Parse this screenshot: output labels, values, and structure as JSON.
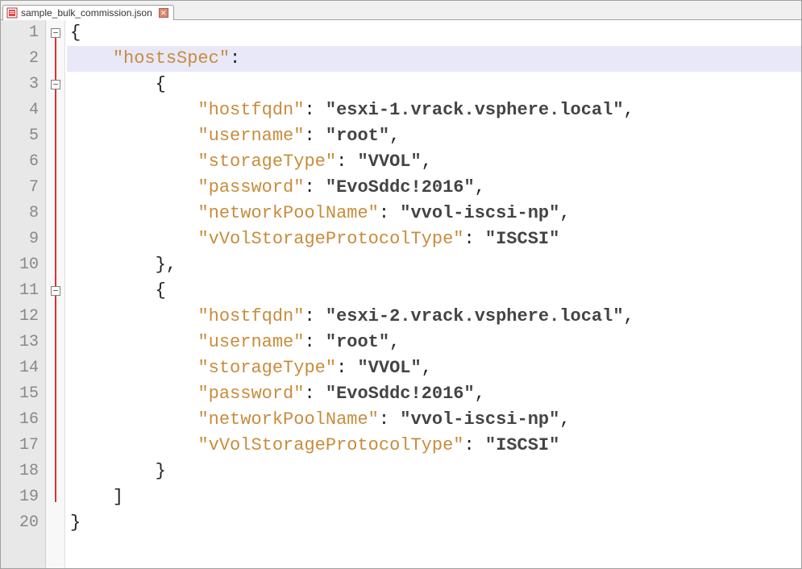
{
  "tab": {
    "filename": "sample_bulk_commission.json",
    "close_glyph": "✕"
  },
  "gutter": {
    "lines": [
      "1",
      "2",
      "3",
      "4",
      "5",
      "6",
      "7",
      "8",
      "9",
      "10",
      "11",
      "12",
      "13",
      "14",
      "15",
      "16",
      "17",
      "18",
      "19",
      "20"
    ]
  },
  "fold": {
    "marks": [
      {
        "line": 1,
        "glyph": "−"
      },
      {
        "line": 3,
        "glyph": "−"
      },
      {
        "line": 11,
        "glyph": "−"
      }
    ]
  },
  "code": {
    "tokens": [
      [
        {
          "t": "{",
          "c": "punc"
        }
      ],
      [
        {
          "t": "    ",
          "c": ""
        },
        {
          "t": "\"hostsSpec\"",
          "c": "key"
        },
        {
          "t": ":",
          "c": "punc"
        }
      ],
      [
        {
          "t": "        ",
          "c": ""
        },
        {
          "t": "{",
          "c": "punc"
        }
      ],
      [
        {
          "t": "            ",
          "c": ""
        },
        {
          "t": "\"hostfqdn\"",
          "c": "key"
        },
        {
          "t": ": ",
          "c": "punc"
        },
        {
          "t": "\"esxi-1.vrack.vsphere.local\"",
          "c": "str"
        },
        {
          "t": ",",
          "c": "punc"
        }
      ],
      [
        {
          "t": "            ",
          "c": ""
        },
        {
          "t": "\"username\"",
          "c": "key"
        },
        {
          "t": ": ",
          "c": "punc"
        },
        {
          "t": "\"root\"",
          "c": "str"
        },
        {
          "t": ",",
          "c": "punc"
        }
      ],
      [
        {
          "t": "            ",
          "c": ""
        },
        {
          "t": "\"storageType\"",
          "c": "key"
        },
        {
          "t": ": ",
          "c": "punc"
        },
        {
          "t": "\"VVOL\"",
          "c": "str"
        },
        {
          "t": ",",
          "c": "punc"
        }
      ],
      [
        {
          "t": "            ",
          "c": ""
        },
        {
          "t": "\"password\"",
          "c": "key"
        },
        {
          "t": ": ",
          "c": "punc"
        },
        {
          "t": "\"EvoSddc!2016\"",
          "c": "str"
        },
        {
          "t": ",",
          "c": "punc"
        }
      ],
      [
        {
          "t": "            ",
          "c": ""
        },
        {
          "t": "\"networkPoolName\"",
          "c": "key"
        },
        {
          "t": ": ",
          "c": "punc"
        },
        {
          "t": "\"vvol-iscsi-np\"",
          "c": "str"
        },
        {
          "t": ",",
          "c": "punc"
        }
      ],
      [
        {
          "t": "            ",
          "c": ""
        },
        {
          "t": "\"vVolStorageProtocolType\"",
          "c": "key"
        },
        {
          "t": ": ",
          "c": "punc"
        },
        {
          "t": "\"ISCSI\"",
          "c": "str"
        }
      ],
      [
        {
          "t": "        ",
          "c": ""
        },
        {
          "t": "},",
          "c": "punc"
        }
      ],
      [
        {
          "t": "        ",
          "c": ""
        },
        {
          "t": "{",
          "c": "punc"
        }
      ],
      [
        {
          "t": "            ",
          "c": ""
        },
        {
          "t": "\"hostfqdn\"",
          "c": "key"
        },
        {
          "t": ": ",
          "c": "punc"
        },
        {
          "t": "\"esxi-2.vrack.vsphere.local\"",
          "c": "str"
        },
        {
          "t": ",",
          "c": "punc"
        }
      ],
      [
        {
          "t": "            ",
          "c": ""
        },
        {
          "t": "\"username\"",
          "c": "key"
        },
        {
          "t": ": ",
          "c": "punc"
        },
        {
          "t": "\"root\"",
          "c": "str"
        },
        {
          "t": ",",
          "c": "punc"
        }
      ],
      [
        {
          "t": "            ",
          "c": ""
        },
        {
          "t": "\"storageType\"",
          "c": "key"
        },
        {
          "t": ": ",
          "c": "punc"
        },
        {
          "t": "\"VVOL\"",
          "c": "str"
        },
        {
          "t": ",",
          "c": "punc"
        }
      ],
      [
        {
          "t": "            ",
          "c": ""
        },
        {
          "t": "\"password\"",
          "c": "key"
        },
        {
          "t": ": ",
          "c": "punc"
        },
        {
          "t": "\"EvoSddc!2016\"",
          "c": "str"
        },
        {
          "t": ",",
          "c": "punc"
        }
      ],
      [
        {
          "t": "            ",
          "c": ""
        },
        {
          "t": "\"networkPoolName\"",
          "c": "key"
        },
        {
          "t": ": ",
          "c": "punc"
        },
        {
          "t": "\"vvol-iscsi-np\"",
          "c": "str"
        },
        {
          "t": ",",
          "c": "punc"
        }
      ],
      [
        {
          "t": "            ",
          "c": ""
        },
        {
          "t": "\"vVolStorageProtocolType\"",
          "c": "key"
        },
        {
          "t": ": ",
          "c": "punc"
        },
        {
          "t": "\"ISCSI\"",
          "c": "str"
        }
      ],
      [
        {
          "t": "        ",
          "c": ""
        },
        {
          "t": "}",
          "c": "punc"
        }
      ],
      [
        {
          "t": "    ",
          "c": ""
        },
        {
          "t": "]",
          "c": "punc"
        }
      ],
      [
        {
          "t": "}",
          "c": "punc"
        }
      ]
    ],
    "highlight_line": 2
  }
}
